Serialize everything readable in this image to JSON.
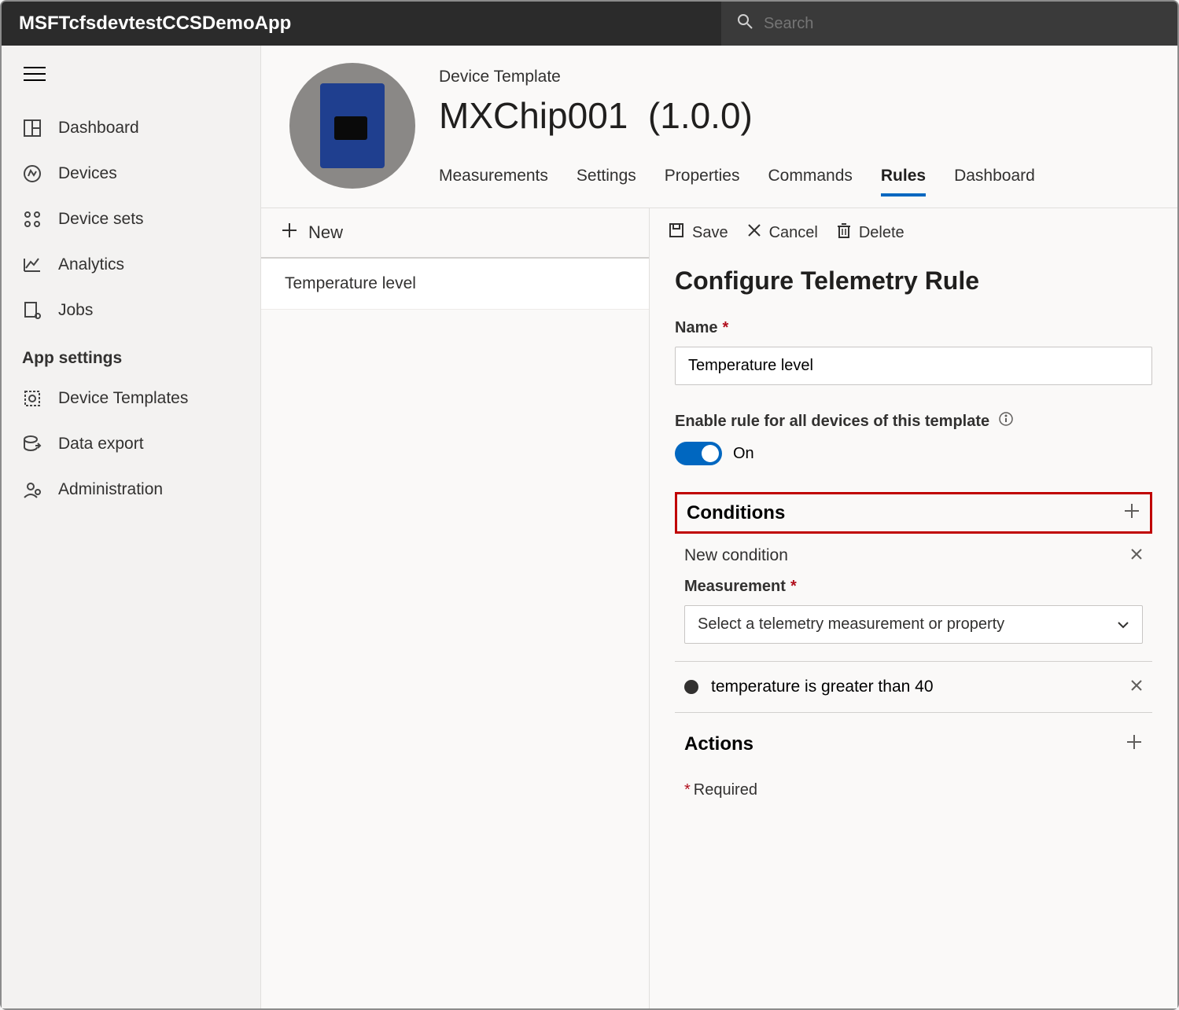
{
  "app": {
    "title": "MSFTcfsdevtestCCSDemoApp"
  },
  "search": {
    "placeholder": "Search"
  },
  "sidebar": {
    "items": [
      {
        "label": "Dashboard"
      },
      {
        "label": "Devices"
      },
      {
        "label": "Device sets"
      },
      {
        "label": "Analytics"
      },
      {
        "label": "Jobs"
      }
    ],
    "heading": "App settings",
    "settings_items": [
      {
        "label": "Device Templates"
      },
      {
        "label": "Data export"
      },
      {
        "label": "Administration"
      }
    ]
  },
  "device": {
    "breadcrumb": "Device Template",
    "name": "MXChip001",
    "version": "(1.0.0)",
    "tabs": [
      {
        "label": "Measurements"
      },
      {
        "label": "Settings"
      },
      {
        "label": "Properties"
      },
      {
        "label": "Commands"
      },
      {
        "label": "Rules"
      },
      {
        "label": "Dashboard"
      }
    ],
    "active_tab": "Rules"
  },
  "rules": {
    "new_btn": "New",
    "items": [
      {
        "name": "Temperature level"
      }
    ]
  },
  "detail": {
    "toolbar": {
      "save": "Save",
      "cancel": "Cancel",
      "delete": "Delete"
    },
    "title": "Configure Telemetry Rule",
    "name_label": "Name",
    "name_value": "Temperature level",
    "enable_label": "Enable rule for all devices of this template",
    "toggle_state": "On",
    "conditions": {
      "heading": "Conditions",
      "new_condition": "New condition",
      "measurement_label": "Measurement",
      "measurement_placeholder": "Select a telemetry measurement or property",
      "existing": "temperature is greater than 40"
    },
    "actions": {
      "heading": "Actions"
    },
    "required_note": "Required"
  }
}
